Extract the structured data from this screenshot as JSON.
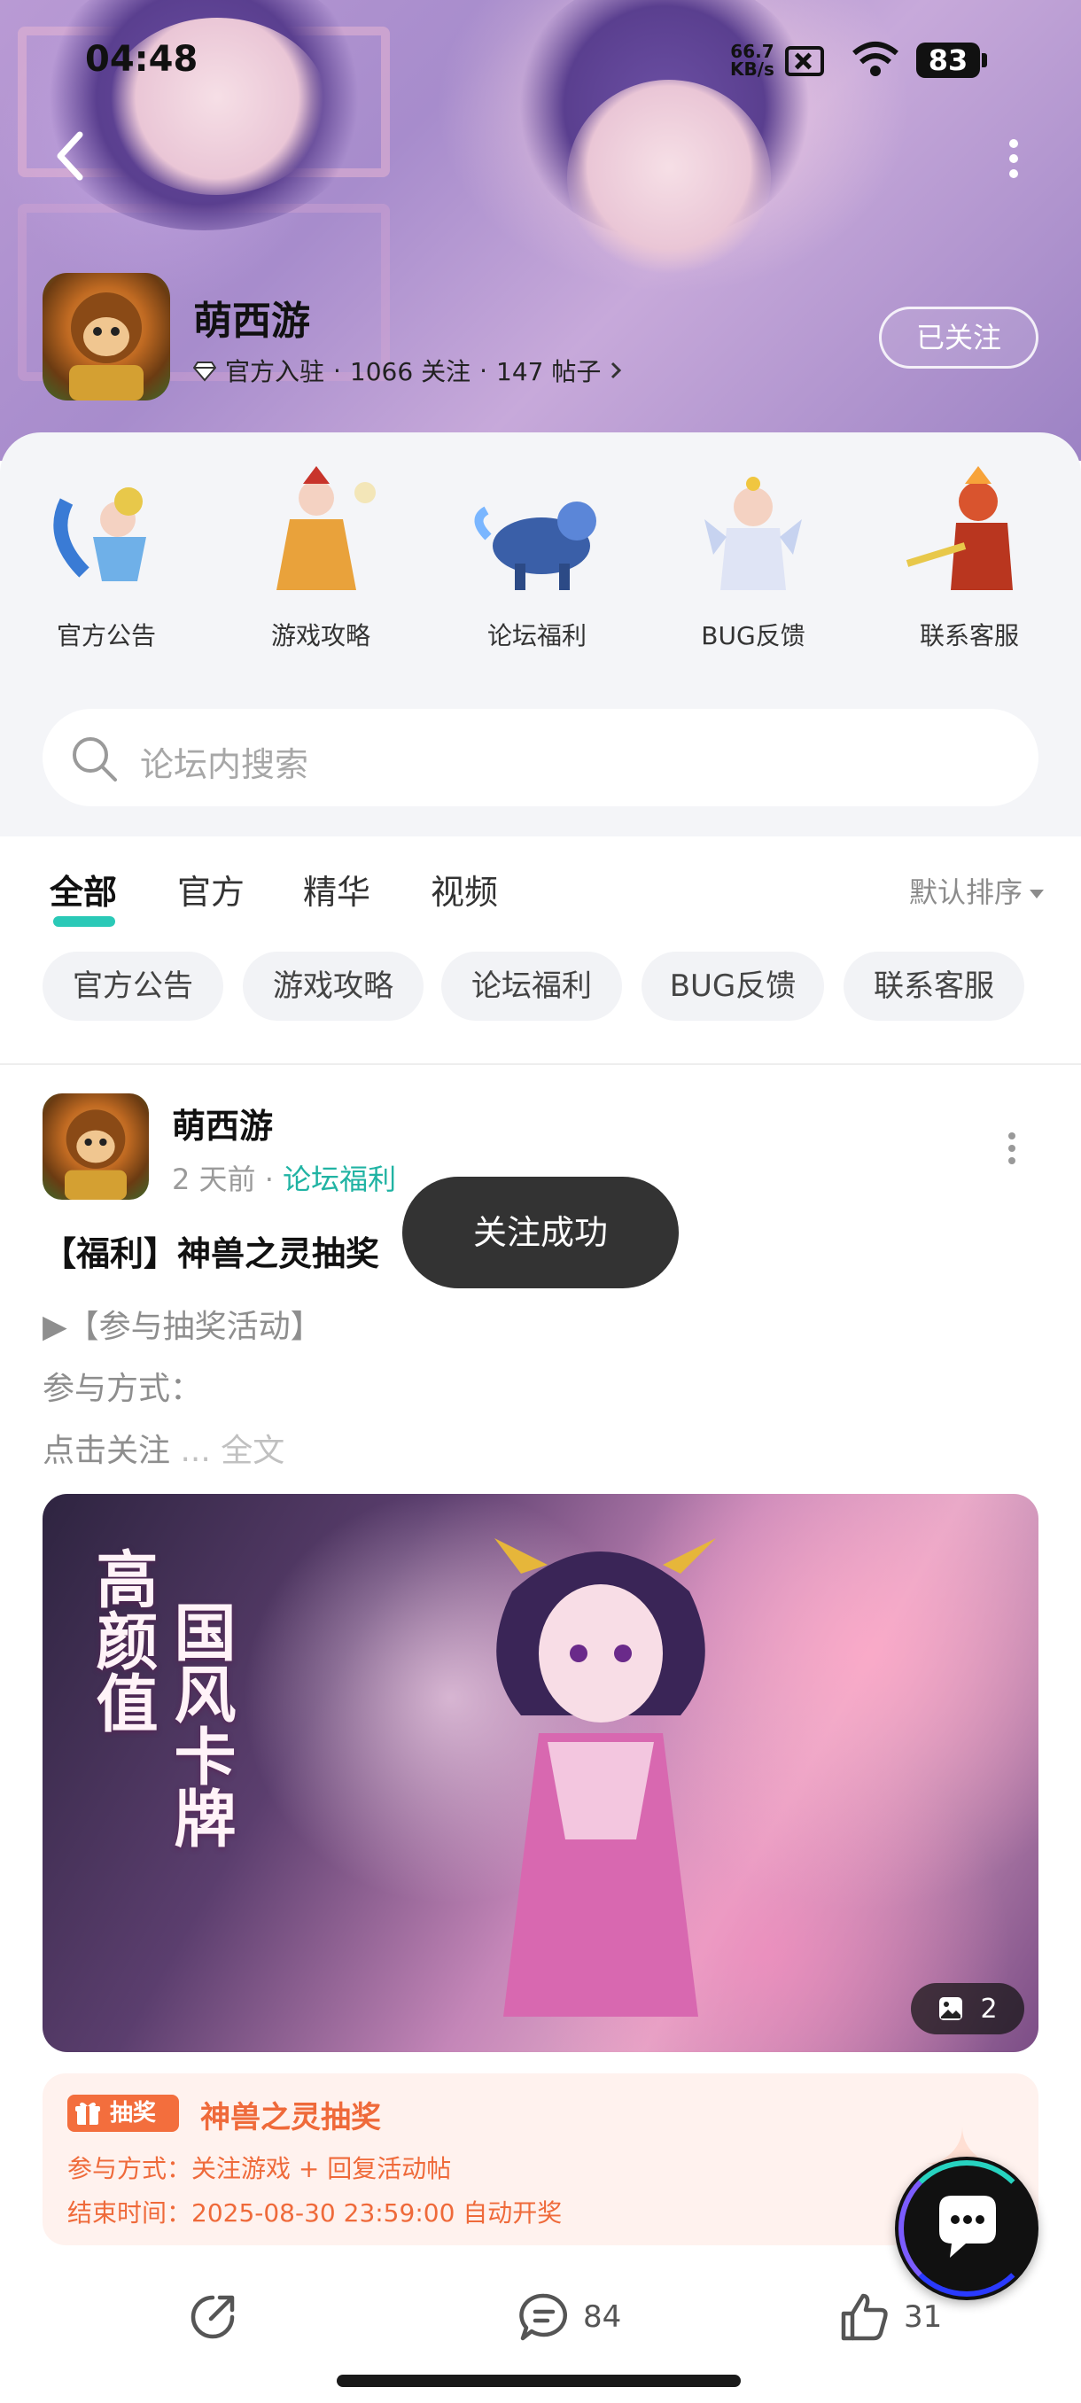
{
  "status_bar": {
    "time": "04:48",
    "net_speed_value": "66.7",
    "net_speed_unit": "KB/s",
    "battery": "83"
  },
  "forum": {
    "name": "萌西游",
    "badge": "官方入驻",
    "followers": "1066 关注",
    "posts": "147 帖子",
    "follow_state": "已关注"
  },
  "categories": [
    {
      "label": "官方公告"
    },
    {
      "label": "游戏攻略"
    },
    {
      "label": "论坛福利"
    },
    {
      "label": "BUG反馈"
    },
    {
      "label": "联系客服"
    }
  ],
  "search": {
    "placeholder": "论坛内搜索"
  },
  "tabs": [
    {
      "label": "全部",
      "active": true
    },
    {
      "label": "官方"
    },
    {
      "label": "精华"
    },
    {
      "label": "视频"
    }
  ],
  "sort": {
    "label": "默认排序"
  },
  "chips": [
    "官方公告",
    "游戏攻略",
    "论坛福利",
    "BUG反馈",
    "联系客服"
  ],
  "post": {
    "author": "萌西游",
    "time": "2 天前",
    "category": "论坛福利",
    "title": "【福利】神兽之灵抽奖",
    "line1": "▶【参与抽奖活动】",
    "line2": "参与方式：",
    "line3": "点击关注",
    "read_more": "... 全文",
    "image_text_1": "高颜值",
    "image_text_2": "国风卡牌",
    "image_count": "2",
    "lottery": {
      "badge": "抽奖",
      "title": "神兽之灵抽奖",
      "method": "参与方式：关注游戏 + 回复活动帖",
      "end_time": "结束时间：2025-08-30 23:59:00 自动开奖"
    },
    "comments": "84",
    "likes": "31"
  },
  "toast": "关注成功",
  "colors": {
    "accent": "#20b3a3",
    "lottery": "#ef6a3a",
    "toast_bg": "#333333"
  }
}
